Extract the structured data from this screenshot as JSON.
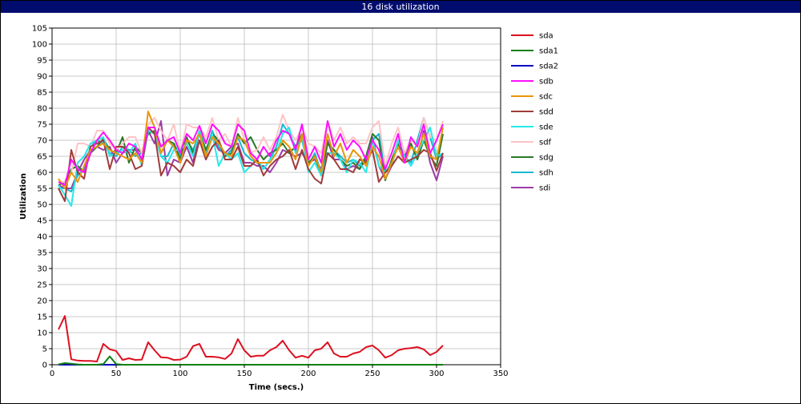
{
  "window": {
    "title": "16 disk utilization"
  },
  "chart_data": {
    "type": "line",
    "title": "16 disk utilization",
    "xlabel": "Time (secs.)",
    "ylabel": "Utilization",
    "xlim": [
      0,
      350
    ],
    "ylim": [
      0,
      105
    ],
    "xticks": [
      0,
      50,
      100,
      150,
      200,
      250,
      300,
      350
    ],
    "yticks": [
      0,
      5,
      10,
      15,
      20,
      25,
      30,
      35,
      40,
      45,
      50,
      55,
      60,
      65,
      70,
      75,
      80,
      85,
      90,
      95,
      100,
      105
    ],
    "grid": true,
    "legend": "right",
    "x": [
      5,
      10,
      15,
      20,
      25,
      30,
      35,
      40,
      45,
      50,
      55,
      60,
      65,
      70,
      75,
      80,
      85,
      90,
      95,
      100,
      105,
      110,
      115,
      120,
      125,
      130,
      135,
      140,
      145,
      150,
      155,
      160,
      165,
      170,
      175,
      180,
      185,
      190,
      195,
      200,
      205,
      210,
      215,
      220,
      225,
      230,
      235,
      240,
      245,
      250,
      255,
      260,
      265,
      270,
      275,
      280,
      285,
      290,
      295,
      300,
      305
    ],
    "series": [
      {
        "name": "sda",
        "color": "#dd1020",
        "values": [
          11,
          15.2,
          1.7,
          1.3,
          1.2,
          1.2,
          1.0,
          6.5,
          4.8,
          4.3,
          1.5,
          2.0,
          1.5,
          1.6,
          7.0,
          4.5,
          2.3,
          2.2,
          1.5,
          1.6,
          2.5,
          5.8,
          6.5,
          2.5,
          2.5,
          2.3,
          1.8,
          3.5,
          8.0,
          4.5,
          2.5,
          2.8,
          2.8,
          4.5,
          5.5,
          7.5,
          4.5,
          2.2,
          2.8,
          2.2,
          4.5,
          5.0,
          7.0,
          3.5,
          2.5,
          2.5,
          3.5,
          4.0,
          5.5,
          6.0,
          4.5,
          2.2,
          3.0,
          4.5,
          5.0,
          5.2,
          5.5,
          4.8,
          3.0,
          4.0,
          6.0
        ]
      },
      {
        "name": "sda1",
        "color": "#108010",
        "values": [
          0.1,
          0.5,
          0.3,
          0.1,
          0,
          0,
          0,
          0.2,
          2.6,
          0.2,
          0,
          0,
          0,
          0,
          0,
          0,
          0,
          0,
          0,
          0,
          0,
          0,
          0,
          0,
          0,
          0,
          0,
          0,
          0,
          0,
          0,
          0,
          0,
          0,
          0,
          0,
          0,
          0,
          0,
          0,
          0,
          0,
          0,
          0,
          0,
          0,
          0,
          0,
          0,
          0,
          0,
          0,
          0,
          0,
          0,
          0,
          0,
          0,
          0,
          0,
          0
        ]
      },
      {
        "name": "sda2",
        "color": "#0000c0",
        "values": [
          0,
          0,
          0,
          0,
          0,
          0,
          0,
          0,
          0,
          0,
          0,
          0,
          0,
          0,
          0,
          0,
          0,
          0,
          0,
          0,
          0,
          0,
          0,
          0,
          0,
          0,
          0,
          0,
          0,
          0,
          0,
          0,
          0,
          0,
          0,
          0,
          0,
          0,
          0,
          0,
          0,
          0,
          0,
          0,
          0,
          0,
          0,
          0,
          0,
          0,
          0,
          0,
          0,
          0,
          0,
          0,
          0,
          0,
          0,
          0,
          0
        ]
      },
      {
        "name": "sdb",
        "color": "#ff10ff",
        "values": [
          57,
          56,
          64,
          61,
          60,
          66,
          70,
          72.5,
          70,
          67,
          66,
          69,
          68,
          64,
          74,
          74,
          68,
          70,
          71,
          66,
          72,
          70,
          74.5,
          69,
          75,
          73,
          69,
          68,
          75,
          73,
          66,
          64,
          68,
          65,
          70,
          73,
          72,
          67,
          75,
          64,
          68,
          63,
          76,
          68,
          72,
          67,
          70,
          68,
          64,
          70,
          67,
          61,
          66,
          72,
          63,
          71,
          68,
          75,
          66,
          70,
          75
        ]
      },
      {
        "name": "sdc",
        "color": "#e8960a",
        "values": [
          58,
          55,
          60,
          57,
          62,
          67,
          68,
          69,
          67,
          66,
          65,
          64,
          66,
          63,
          79,
          74,
          66,
          70,
          68,
          63,
          70,
          69,
          72,
          65,
          71,
          69,
          66,
          65,
          71,
          70,
          65,
          63,
          63,
          63,
          66,
          70,
          68,
          64,
          72,
          62,
          65,
          60,
          72,
          65,
          69,
          63,
          67,
          65,
          62,
          68,
          65,
          58,
          63,
          68,
          63,
          68,
          66,
          72,
          65,
          64,
          74
        ]
      },
      {
        "name": "sdd",
        "color": "#a03c3c",
        "values": [
          55,
          51,
          67,
          60,
          58,
          68,
          69,
          70,
          61,
          68,
          68,
          66,
          61,
          62,
          74,
          72,
          59,
          63,
          62,
          60,
          64,
          62,
          70,
          64,
          68,
          70,
          64,
          64,
          68,
          62,
          62,
          64,
          59,
          62,
          64,
          65,
          67,
          61,
          67,
          61,
          58,
          56.5,
          66,
          64,
          61,
          61,
          60,
          64,
          63,
          67,
          57,
          60,
          62,
          65,
          63,
          64,
          65,
          67,
          66,
          60.5,
          66
        ]
      },
      {
        "name": "sde",
        "color": "#28e8e8",
        "values": [
          56,
          53,
          49.5,
          63,
          65,
          69,
          70,
          71,
          65,
          66,
          67,
          66,
          69,
          62,
          73,
          72,
          65,
          63,
          67,
          67,
          69,
          65,
          73,
          65,
          72,
          62,
          66,
          64,
          66,
          60,
          62,
          64,
          61,
          64,
          66,
          72,
          74,
          66,
          71,
          60,
          63,
          59,
          66,
          66,
          64,
          60,
          64,
          63,
          60,
          70,
          62,
          60,
          62,
          70,
          65,
          62,
          66,
          70,
          74,
          65,
          66
        ]
      },
      {
        "name": "sdf",
        "color": "#ffc4c4",
        "values": [
          57,
          57,
          60,
          69,
          69,
          68,
          73,
          73,
          69,
          67,
          69,
          71,
          71,
          66,
          75,
          77,
          73,
          70,
          75,
          66,
          75,
          74,
          74,
          71,
          77,
          70,
          72,
          68,
          77,
          70,
          66,
          67,
          71,
          67,
          71,
          78,
          73,
          70,
          74,
          69,
          68,
          66,
          76,
          70,
          74,
          69,
          71,
          69,
          69,
          74,
          76,
          62,
          69,
          74,
          66,
          70,
          68,
          77,
          71,
          70,
          76
        ]
      },
      {
        "name": "sdg",
        "color": "#2a7a2a",
        "values": [
          56,
          57,
          61,
          62,
          60,
          66,
          68,
          70.5,
          67,
          66,
          71,
          63,
          68,
          66,
          72,
          73,
          66,
          70,
          69,
          64,
          71,
          66,
          73,
          67,
          72,
          70,
          65,
          66,
          72,
          69,
          71,
          67,
          64,
          66,
          67,
          69,
          66,
          68,
          72,
          63,
          65,
          59,
          69,
          67,
          64,
          62,
          63,
          61,
          65,
          72,
          70,
          57.5,
          64,
          69,
          65,
          69,
          64,
          70,
          65,
          62,
          72
        ]
      },
      {
        "name": "sdh",
        "color": "#18b8d0",
        "values": [
          55,
          55,
          54,
          59,
          61,
          68,
          70,
          69,
          66,
          65,
          68,
          67,
          65,
          66,
          73,
          72,
          65,
          65,
          69,
          65,
          70,
          67,
          72,
          66,
          73,
          68,
          65,
          67,
          71,
          66,
          64,
          63,
          61,
          64,
          68,
          75,
          72,
          68,
          70,
          62,
          66,
          60,
          69,
          67,
          65,
          63,
          64,
          62,
          65,
          70,
          72,
          60,
          63,
          70,
          65,
          63,
          70,
          77,
          71,
          64,
          66
        ]
      },
      {
        "name": "sdi",
        "color": "#9c3ca8",
        "values": [
          56,
          55,
          55,
          60,
          64,
          67,
          68,
          67,
          68,
          63,
          66,
          67,
          67,
          64,
          73,
          69,
          76,
          59,
          64,
          63,
          68,
          63,
          73,
          66,
          71,
          67,
          66,
          68,
          69,
          63,
          63,
          62,
          62,
          60,
          63,
          67,
          66,
          65,
          66,
          63,
          64,
          61,
          70,
          64,
          64,
          61,
          62,
          61,
          64,
          71,
          62,
          58,
          62,
          65,
          63,
          69,
          64,
          73,
          63,
          57.5,
          65
        ]
      }
    ]
  }
}
